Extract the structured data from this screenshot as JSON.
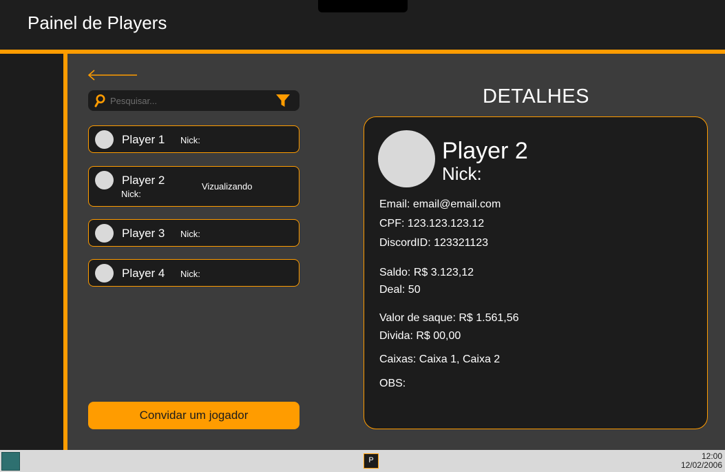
{
  "app": {
    "title": "Painel de Players"
  },
  "search": {
    "placeholder": "Pesquisar..."
  },
  "players": [
    {
      "name": "Player 1",
      "nick": "Nick:"
    },
    {
      "name": "Player 2",
      "nick": "Nick:",
      "status": "Vizualizando"
    },
    {
      "name": "Player 3",
      "nick": "Nick:"
    },
    {
      "name": "Player 4",
      "nick": "Nick:"
    }
  ],
  "invite_label": "Convidar um jogador",
  "details": {
    "heading": "DETALHES",
    "name": "Player 2",
    "nick": "Nick:",
    "email": "Email: email@email.com",
    "cpf": "CPF: 123.123.123.12",
    "discord": "DiscordID: 123321123",
    "saldo": "Saldo: R$ 3.123,12",
    "deal": "Deal: 50",
    "saque": "Valor de saque: R$ 1.561,56",
    "divida": "Divida: R$ 00,00",
    "caixas": "Caixas: Caixa 1, Caixa 2",
    "obs": "OBS:"
  },
  "taskbar": {
    "app_letter": "P",
    "time": "12:00",
    "date": "12/02/2006"
  },
  "colors": {
    "accent": "#ff9c00",
    "panel": "#1c1c1c",
    "background": "#3c3c3c",
    "avatar": "#d9d9d9"
  },
  "icons": {
    "back": "arrow-left-icon",
    "search": "search-icon",
    "filter": "filter-icon"
  }
}
